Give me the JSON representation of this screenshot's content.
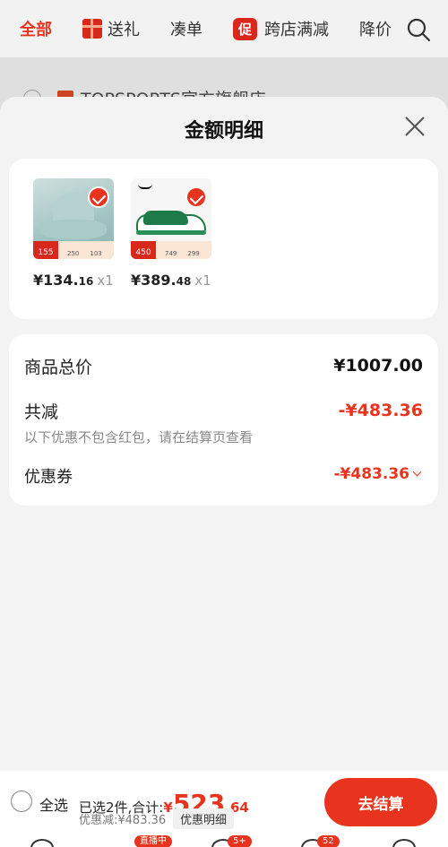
{
  "topbar": {
    "tabs": [
      {
        "label": "全部"
      },
      {
        "label": "送礼"
      },
      {
        "label": "凑单"
      },
      {
        "label": "跨店满减",
        "badge": "促"
      },
      {
        "label": "降价"
      }
    ]
  },
  "background": {
    "store_name": "TOPSPORTS官方旗舰店"
  },
  "sheet": {
    "title": "金额明细",
    "products": [
      {
        "price_int": "¥134.",
        "price_dec": "16",
        "qty": "x1",
        "tag_price": "155",
        "tag_mid": "250",
        "tag_right": "103"
      },
      {
        "price_int": "¥389.",
        "price_dec": "48",
        "qty": "x1",
        "tag_price": "450",
        "tag_mid": "749",
        "tag_right": "299"
      }
    ],
    "summary": {
      "total_label": "商品总价",
      "total_value": "¥1007.00",
      "reduce_label": "共减",
      "reduce_value": "-¥483.36",
      "note": "以下优惠不包含红包，请在结算页查看",
      "coupon_label": "优惠券",
      "coupon_value": "-¥483.36"
    }
  },
  "bottombar": {
    "select_all": "全选",
    "selected_text": "已选2件,合计:",
    "total_currency": "¥",
    "total_int": "523",
    "total_dec": ".64",
    "discount_text": "优惠减:¥483.36",
    "detail_button": "优惠明细",
    "checkout_label": "去结算"
  },
  "navbar": {
    "badges": [
      "直播中",
      "5+",
      "52"
    ]
  }
}
